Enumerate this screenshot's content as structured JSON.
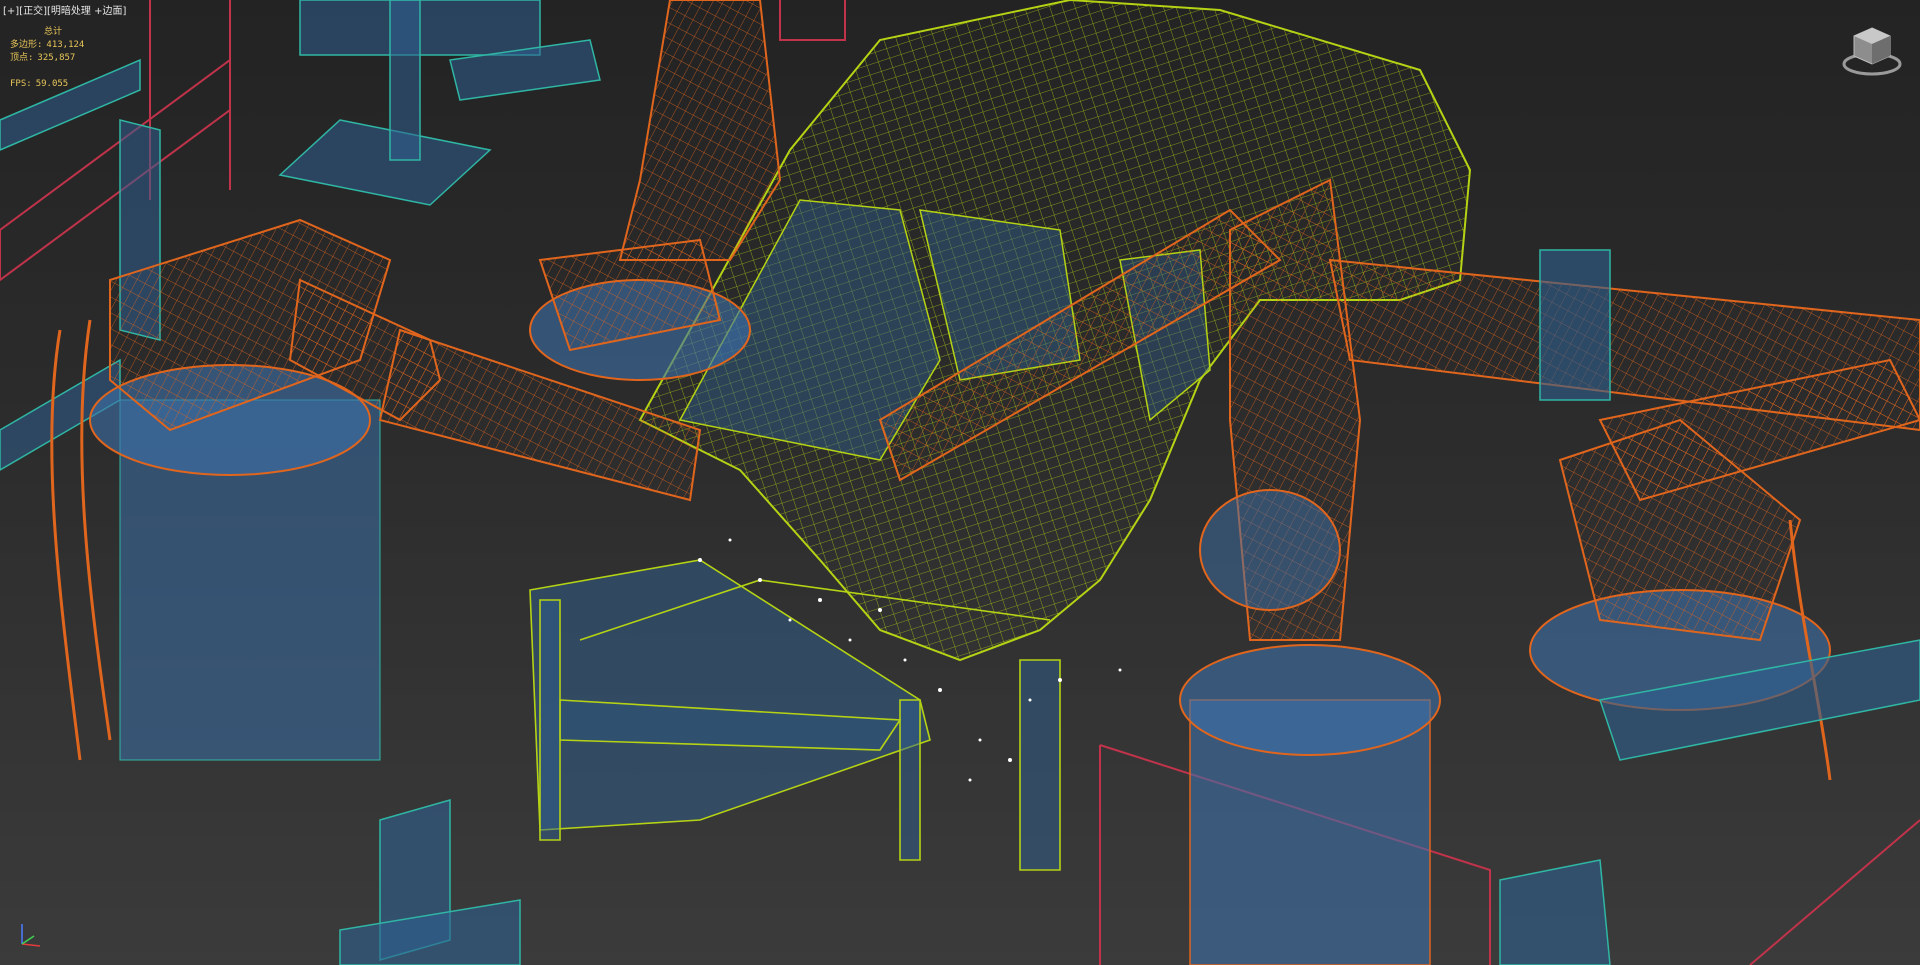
{
  "viewport": {
    "label_plus": "[+]",
    "label_view": "[正交]",
    "label_shading": "[明暗处理 +",
    "label_edges": "边面]"
  },
  "stats": {
    "title": "总计",
    "polys_label": "多边形:",
    "polys_value": "413,124",
    "verts_label": "顶点:",
    "verts_value": "325,857",
    "fps_label": "FPS:",
    "fps_value": "59.055"
  },
  "colors": {
    "background_top": "#232323",
    "background_bottom": "#3b3b3b",
    "robot_wire": "#e0651d",
    "robot_fill": "#3d6fa8",
    "car_wire": "#b5d214",
    "fixture_wire": "#2fb6a4",
    "fixture_fill": "#2f5f8f",
    "fence_wire": "#c0334a",
    "stats_text": "#e8c65a"
  },
  "icons": {
    "viewcube": "viewcube-icon",
    "axis": "axis-tripod-icon"
  }
}
